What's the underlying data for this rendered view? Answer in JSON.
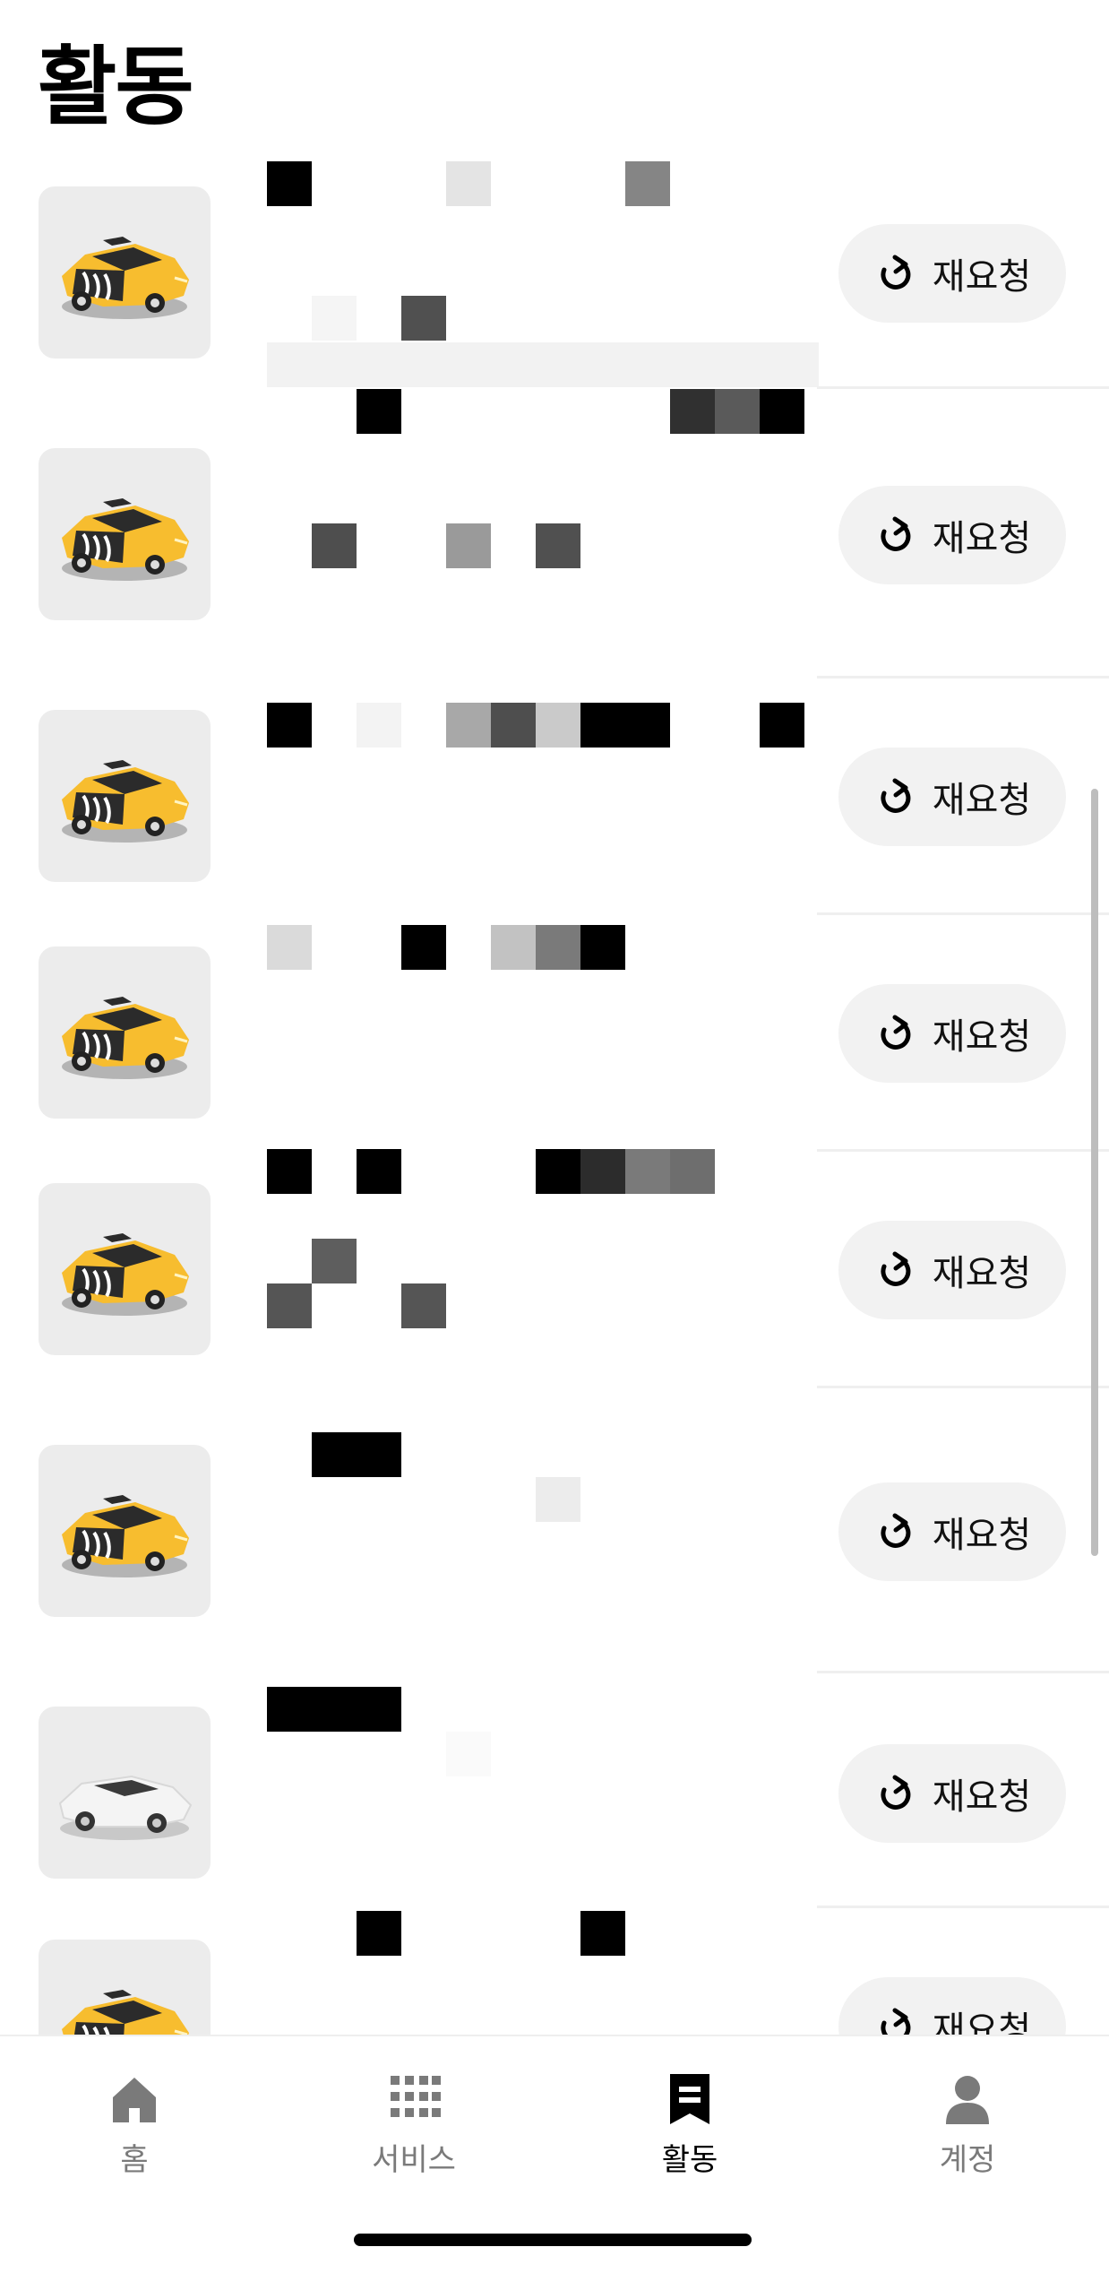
{
  "header": {
    "title": "활동"
  },
  "activities": [
    {
      "vehicle": "taxi",
      "button_label": "재요청"
    },
    {
      "vehicle": "taxi",
      "button_label": "재요청"
    },
    {
      "vehicle": "taxi",
      "button_label": "재요청"
    },
    {
      "vehicle": "taxi",
      "button_label": "재요청"
    },
    {
      "vehicle": "taxi",
      "button_label": "재요청"
    },
    {
      "vehicle": "taxi",
      "button_label": "재요청"
    },
    {
      "vehicle": "white-car",
      "button_label": "재요청"
    },
    {
      "vehicle": "taxi",
      "button_label": "재요청"
    }
  ],
  "tabbar": {
    "home": "홈",
    "services": "서비스",
    "activity": "활동",
    "account": "계정",
    "active_tab": "activity"
  },
  "icons": {
    "rerequest": "refresh-icon",
    "home": "home-icon",
    "services": "grid-icon",
    "activity": "receipt-icon",
    "account": "person-icon"
  },
  "colors": {
    "taxi_yellow": "#f7bd2f",
    "button_bg": "#f2f2f2",
    "thumb_bg": "#ececec",
    "inactive_tab": "#7a7a7a"
  }
}
